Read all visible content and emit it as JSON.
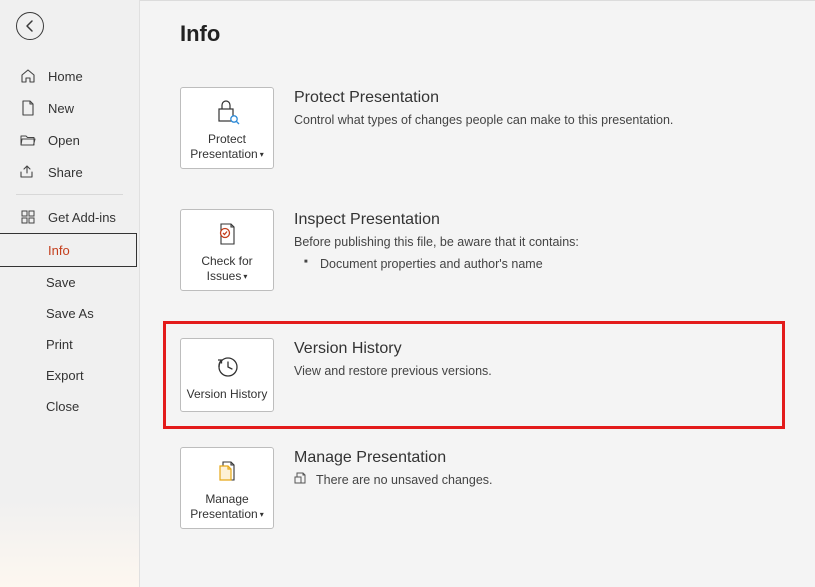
{
  "sidebar": {
    "back_aria": "Back",
    "items": [
      {
        "label": "Home"
      },
      {
        "label": "New"
      },
      {
        "label": "Open"
      },
      {
        "label": "Share"
      },
      {
        "label": "Get Add-ins"
      },
      {
        "label": "Info"
      },
      {
        "label": "Save"
      },
      {
        "label": "Save As"
      },
      {
        "label": "Print"
      },
      {
        "label": "Export"
      },
      {
        "label": "Close"
      }
    ]
  },
  "main": {
    "title": "Info",
    "protect": {
      "button": "Protect Presentation",
      "title": "Protect Presentation",
      "desc": "Control what types of changes people can make to this presentation."
    },
    "inspect": {
      "button": "Check for Issues",
      "title": "Inspect Presentation",
      "desc": "Before publishing this file, be aware that it contains:",
      "items": [
        "Document properties and author's name"
      ]
    },
    "version": {
      "button": "Version History",
      "title": "Version History",
      "desc": "View and restore previous versions."
    },
    "manage": {
      "button": "Manage Presentation",
      "title": "Manage Presentation",
      "desc": "There are no unsaved changes."
    }
  }
}
